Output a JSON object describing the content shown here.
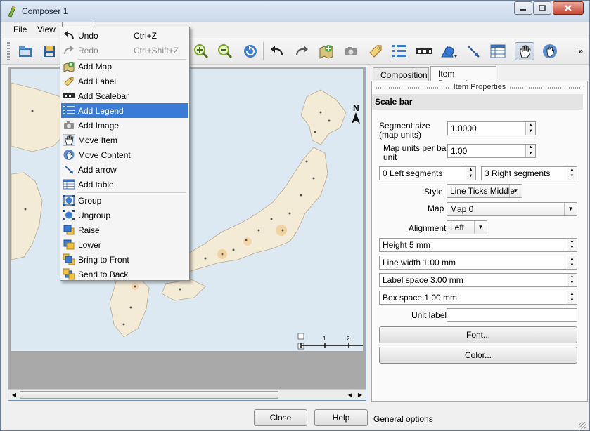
{
  "window": {
    "title": "Composer 1"
  },
  "menubar": {
    "file": "File",
    "view": "View"
  },
  "toolbar": {
    "overflow": "»"
  },
  "edit_menu": {
    "undo": {
      "label": "Undo",
      "shortcut": "Ctrl+Z"
    },
    "redo": {
      "label": "Redo",
      "shortcut": "Ctrl+Shift+Z"
    },
    "items": [
      "Add Map",
      "Add Label",
      "Add Scalebar",
      "Add Legend",
      "Add Image",
      "Move Item",
      "Move Content",
      "Add arrow",
      "Add table",
      "Group",
      "Ungroup",
      "Raise",
      "Lower",
      "Bring to Front",
      "Send to Back"
    ],
    "highlighted": "Add Legend"
  },
  "map": {
    "north_label": "N",
    "scale_ticks": [
      "1",
      "2"
    ]
  },
  "panel": {
    "tabs": [
      "Composition",
      "Item Properties"
    ],
    "active_tab": "Item Properties",
    "dock_title": "Item Properties",
    "section_title": "Scale bar",
    "segment_size_label": "Segment size (map units)",
    "segment_size_value": "1.0000",
    "map_units_label": "Map units per bar unit",
    "map_units_value": "1.00",
    "left_segments": "0 Left segments",
    "right_segments": "3 Right segments",
    "style_label": "Style",
    "style_value": "Line Ticks Middle",
    "map_label": "Map",
    "map_value": "Map 0",
    "alignment_label": "Alignment",
    "alignment_value": "Left",
    "height": "Height 5 mm",
    "line_width": "Line width 1.00 mm",
    "label_space": "Label space 3.00 mm",
    "box_space": "Box space 1.00 mm",
    "unit_label": "Unit label",
    "unit_value": "",
    "font_button": "Font...",
    "color_button": "Color..."
  },
  "bottom": {
    "close": "Close",
    "help": "Help",
    "status": "General options"
  }
}
